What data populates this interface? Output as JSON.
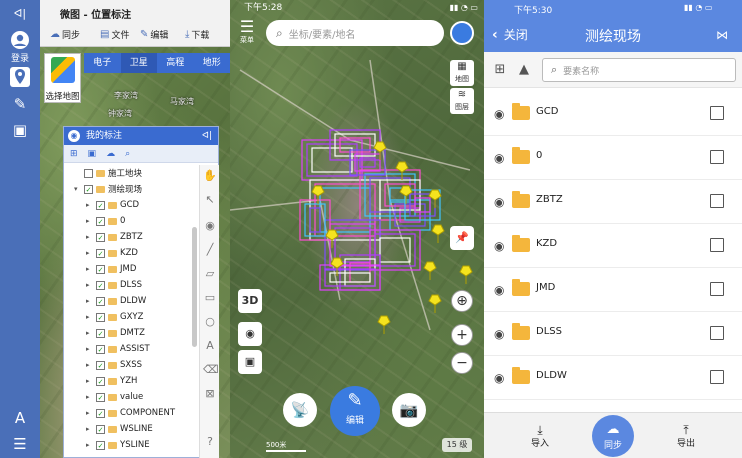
{
  "desktop": {
    "rail": {
      "login_label": "登录"
    },
    "toolbar": {
      "title": "微图 - 位置标注",
      "buttons": [
        "同步",
        "文件",
        "编辑",
        "下载"
      ]
    },
    "base_tabs": [
      "电子",
      "卫星",
      "高程",
      "地形"
    ],
    "map_selector_label": "选择地图",
    "places": [
      "李家湾",
      "马家湾",
      "钟家湾"
    ],
    "layer_panel": {
      "title": "我的标注",
      "rows": [
        {
          "label": "施工地块",
          "level": 1,
          "checked": false
        },
        {
          "label": "测绘现场",
          "level": 1,
          "checked": true
        },
        {
          "label": "GCD",
          "level": 2,
          "checked": true
        },
        {
          "label": "0",
          "level": 2,
          "checked": true
        },
        {
          "label": "ZBTZ",
          "level": 2,
          "checked": true
        },
        {
          "label": "KZD",
          "level": 2,
          "checked": true
        },
        {
          "label": "JMD",
          "level": 2,
          "checked": true
        },
        {
          "label": "DLSS",
          "level": 2,
          "checked": true
        },
        {
          "label": "DLDW",
          "level": 2,
          "checked": true
        },
        {
          "label": "GXYZ",
          "level": 2,
          "checked": true
        },
        {
          "label": "DMTZ",
          "level": 2,
          "checked": true
        },
        {
          "label": "ASSIST",
          "level": 2,
          "checked": true
        },
        {
          "label": "SXSS",
          "level": 2,
          "checked": true
        },
        {
          "label": "YZH",
          "level": 2,
          "checked": true
        },
        {
          "label": "value",
          "level": 2,
          "checked": true
        },
        {
          "label": "COMPONENT",
          "level": 2,
          "checked": true
        },
        {
          "label": "WSLINE",
          "level": 2,
          "checked": true
        },
        {
          "label": "YSLINE",
          "level": 2,
          "checked": true
        }
      ]
    }
  },
  "phone_map": {
    "status_time": "下午5:28",
    "menu_label": "菜单",
    "search_placeholder": "坐标/要素/地名",
    "map_button": "地图",
    "layers_button": "图层",
    "btn_3d": "3D",
    "edit_label": "编辑",
    "scale_label": "500米",
    "zoom_level": "15 级"
  },
  "survey_list": {
    "status_time": "下午5:30",
    "back_label": "关闭",
    "title": "测绘现场",
    "search_placeholder": "要素名称",
    "items": [
      "GCD",
      "0",
      "ZBTZ",
      "KZD",
      "JMD",
      "DLSS",
      "DLDW"
    ],
    "bottom": {
      "import": "导入",
      "sync": "同步",
      "export": "导出"
    }
  },
  "colors": {
    "accent": "#3a6bd0",
    "header": "#5b88e0",
    "folder": "#f4b63c",
    "pin": "#f5e31e"
  }
}
